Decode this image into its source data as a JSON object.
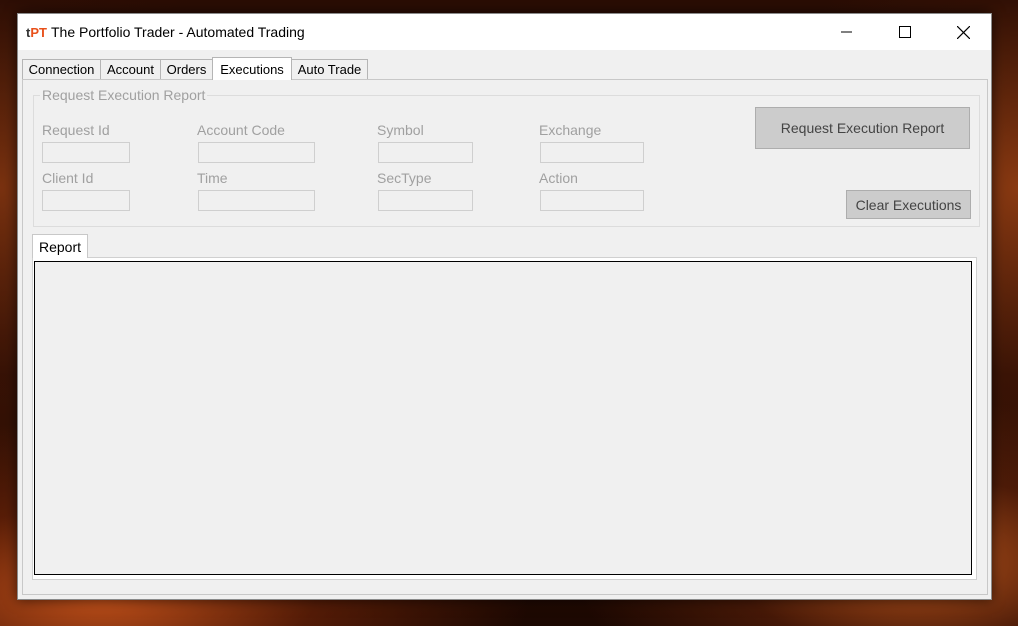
{
  "window": {
    "logo_prefix": "t",
    "logo_main": "PT",
    "title": "The Portfolio Trader - Automated Trading"
  },
  "tabs": [
    {
      "label": "Connection"
    },
    {
      "label": "Account"
    },
    {
      "label": "Orders"
    },
    {
      "label": "Executions"
    },
    {
      "label": "Auto Trade"
    }
  ],
  "active_tab": "Executions",
  "group": {
    "title": "Request Execution Report",
    "fields": {
      "request_id": {
        "label": "Request Id",
        "value": ""
      },
      "account_code": {
        "label": "Account Code",
        "value": ""
      },
      "symbol": {
        "label": "Symbol",
        "value": ""
      },
      "exchange": {
        "label": "Exchange",
        "value": ""
      },
      "client_id": {
        "label": "Client Id",
        "value": ""
      },
      "time": {
        "label": "Time",
        "value": ""
      },
      "sectype": {
        "label": "SecType",
        "value": ""
      },
      "action": {
        "label": "Action",
        "value": ""
      }
    },
    "request_button": "Request Execution Report",
    "clear_button": "Clear Executions"
  },
  "report": {
    "tab_label": "Report",
    "content": ""
  },
  "icons": [
    "minimize-icon",
    "maximize-icon",
    "close-icon"
  ],
  "colors": {
    "logo_accent": "#e8501a",
    "disabled_text": "#a0a0a0",
    "button_bg": "#cccccc"
  }
}
